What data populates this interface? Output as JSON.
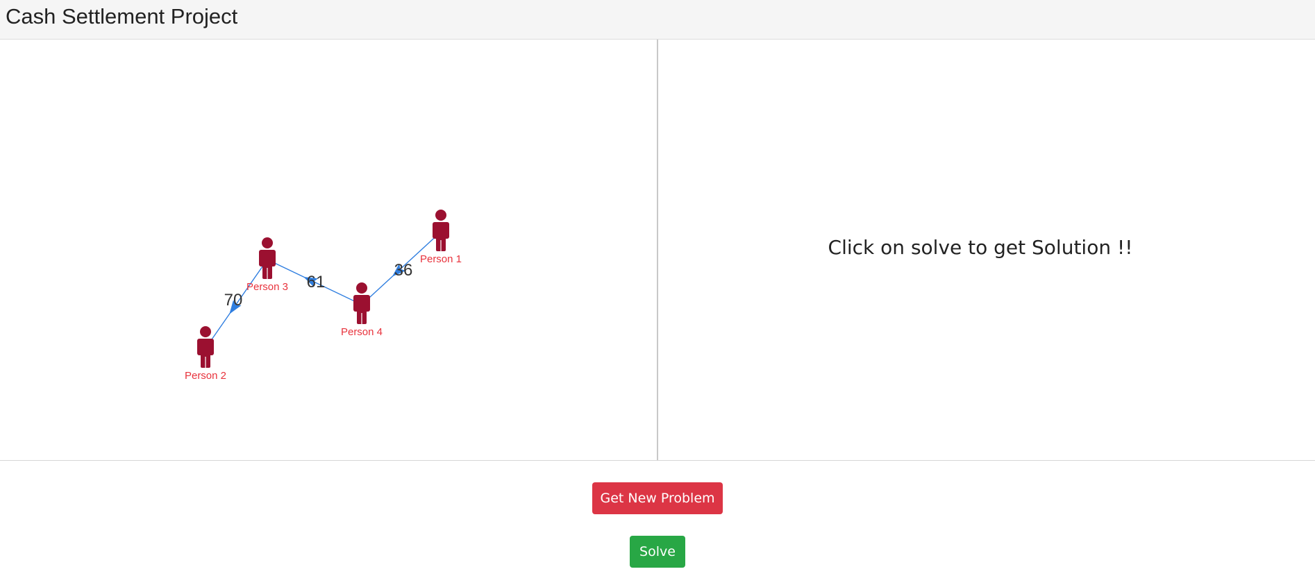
{
  "app": {
    "title": "Cash Settlement Project"
  },
  "graph": {
    "nodes": [
      {
        "id": "p1",
        "label": "Person 1",
        "color": "#9b1030"
      },
      {
        "id": "p2",
        "label": "Person 2",
        "color": "#9b1030"
      },
      {
        "id": "p3",
        "label": "Person 3",
        "color": "#9b1030"
      },
      {
        "id": "p4",
        "label": "Person 4",
        "color": "#9b1030"
      }
    ],
    "edges": [
      {
        "from": "p3",
        "to": "p2",
        "amount": "70"
      },
      {
        "from": "p4",
        "to": "p3",
        "amount": "61"
      },
      {
        "from": "p1",
        "to": "p4",
        "amount": "36"
      }
    ],
    "label_color": "#e8323c",
    "edge_color": "#2f7ee0",
    "node_icon": "person-icon"
  },
  "solution": {
    "message": "Click on solve to get Solution !!"
  },
  "actions": {
    "new_problem_label": "Get New Problem",
    "solve_label": "Solve"
  },
  "colors": {
    "danger": "#dc3545",
    "success": "#28a745"
  }
}
